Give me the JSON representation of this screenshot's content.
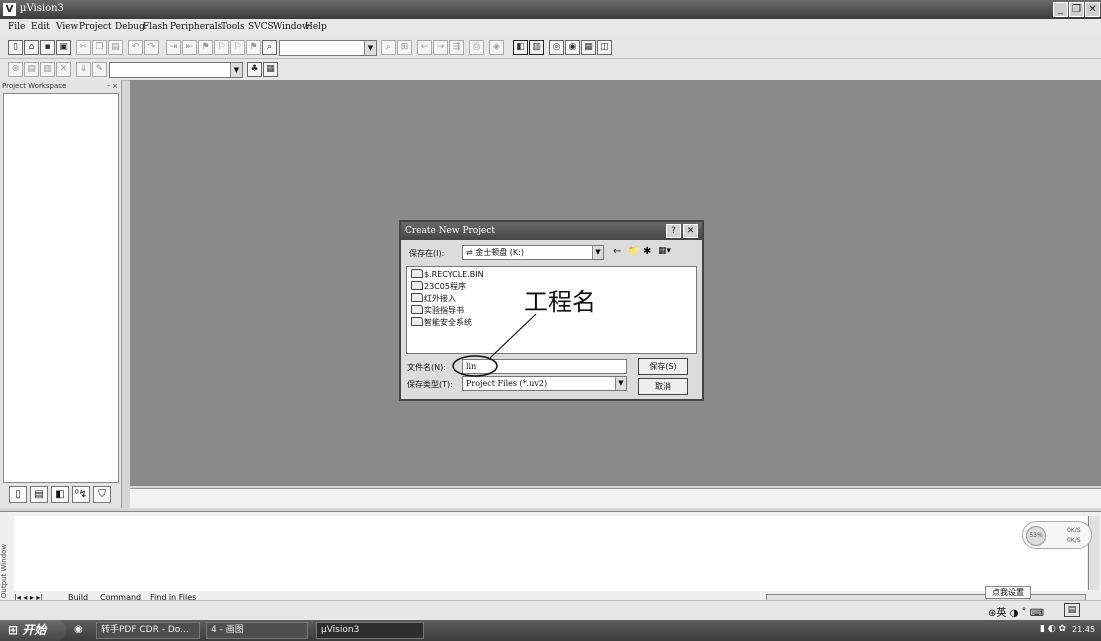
{
  "window": {
    "title": "µVision3",
    "logo_glyph": "V",
    "controls": [
      "_",
      "❐",
      "✕"
    ]
  },
  "menubar": [
    "File",
    "Edit",
    "View",
    "Project",
    "Debug",
    "Flash",
    "Peripherals",
    "Tools",
    "SVCS",
    "Window",
    "Help"
  ],
  "workspace": {
    "title": "Project Workspace",
    "controls": "- ×",
    "tabs": [
      "▯",
      "▤",
      "◧",
      "⁰↯",
      "⛉"
    ]
  },
  "dialog": {
    "title": "Create New Project",
    "help_button": "?",
    "close_button": "✕",
    "save_in_label": "保存在(I):",
    "save_in_value": "金士顿盘 (K:)",
    "folders": [
      "$.RECYCLE.BIN",
      "23C05程序",
      "红外接入",
      "实验指导书",
      "智能安全系统"
    ],
    "filename_label": "文件名(N):",
    "filename_value": "lin",
    "filetype_label": "保存类型(T):",
    "filetype_value": "Project Files (*.uv2)",
    "save_button": "保存(S)",
    "cancel_button": "取消",
    "nav_icons": [
      "←",
      "📁",
      "✱",
      "▦▾"
    ]
  },
  "annotation": {
    "text": "工程名"
  },
  "output": {
    "side_label": "Output Window",
    "tabs": [
      "Build",
      "Command",
      "Find in Files"
    ],
    "speed": {
      "percent": "53%",
      "up": "0K/S",
      "down": "0K/S"
    }
  },
  "ime_popup": "点我设置",
  "taskbar": {
    "start": "开始",
    "tasks": [
      "转手PDF CDR - Do...",
      "4 - 画图",
      "µVision3"
    ],
    "clock": "21:45"
  },
  "statusbar": {
    "ime": "英"
  }
}
